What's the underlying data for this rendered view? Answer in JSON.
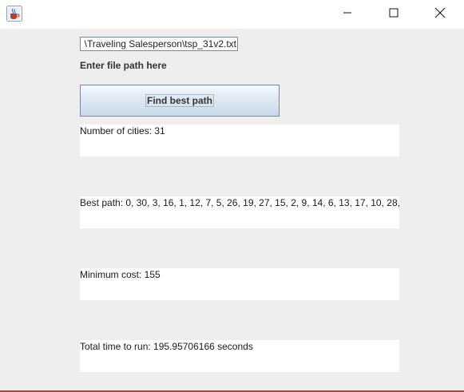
{
  "window": {
    "icon": "java-cup-icon",
    "controls": [
      "minimize-icon",
      "maximize-icon",
      "close-icon"
    ]
  },
  "form": {
    "file_path_value": "\\Traveling Salesperson\\tsp_31v2.txt",
    "file_label": "Enter file path here",
    "find_button_label": "Find best path"
  },
  "results": {
    "cities": "Number of cities: 31",
    "best_path": "Best path: 0, 30, 3, 16, 1, 12, 7, 5, 26, 19, 27, 15, 2, 9, 14, 6, 13, 17, 10, 28,",
    "min_cost": "Minimum cost: 155",
    "total_time": "Total time to run: 195.95706166 seconds"
  },
  "colors": {
    "background": "#eeeeee",
    "titlebar": "#ffffff",
    "button_gradient_top": "#f4f8fc",
    "button_gradient_bottom": "#c8d9ea",
    "bottom_accent": "#c0392b"
  }
}
